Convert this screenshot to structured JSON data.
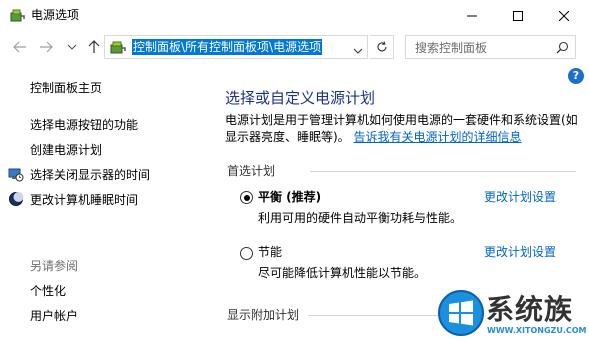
{
  "window": {
    "title": "电源选项",
    "controls": [
      "minimize",
      "maximize",
      "close"
    ]
  },
  "navbar": {
    "address": "控制面板\\所有控制面板项\\电源选项",
    "search_placeholder": "搜索控制面板"
  },
  "sidebar": {
    "home": "控制面板主页",
    "items": [
      {
        "label": "选择电源按钮的功能",
        "icon": null
      },
      {
        "label": "创建电源计划",
        "icon": null
      },
      {
        "label": "选择关闭显示器的时间",
        "icon": "monitor-clock-icon"
      },
      {
        "label": "更改计算机睡眠时间",
        "icon": "moon-icon"
      }
    ],
    "see_also_header": "另请参阅",
    "see_also": [
      {
        "label": "个性化"
      },
      {
        "label": "用户帐户"
      }
    ]
  },
  "main": {
    "title": "选择或自定义电源计划",
    "description": "电源计划是用于管理计算机如何使用电源的一套硬件和系统设置(如显示器亮度、睡眠等)。",
    "description_link": "告诉我有关电源计划的详细信息",
    "preferred_header": "首选计划",
    "plans": [
      {
        "name": "平衡 (推荐)",
        "desc": "利用可用的硬件自动平衡功耗与性能。",
        "link": "更改计划设置",
        "selected": true
      },
      {
        "name": "节能",
        "desc": "尽可能降低计算机性能以节能。",
        "link": "更改计划设置",
        "selected": false
      }
    ],
    "additional_header": "显示附加计划"
  },
  "watermark": {
    "brand": "系统族",
    "url": "WWW.XITONGZU.COM"
  },
  "colors": {
    "title_blue": "#1e3287",
    "link_blue": "#0066cc",
    "selection_blue": "#0078d7",
    "help_blue": "#1a6fc9"
  }
}
